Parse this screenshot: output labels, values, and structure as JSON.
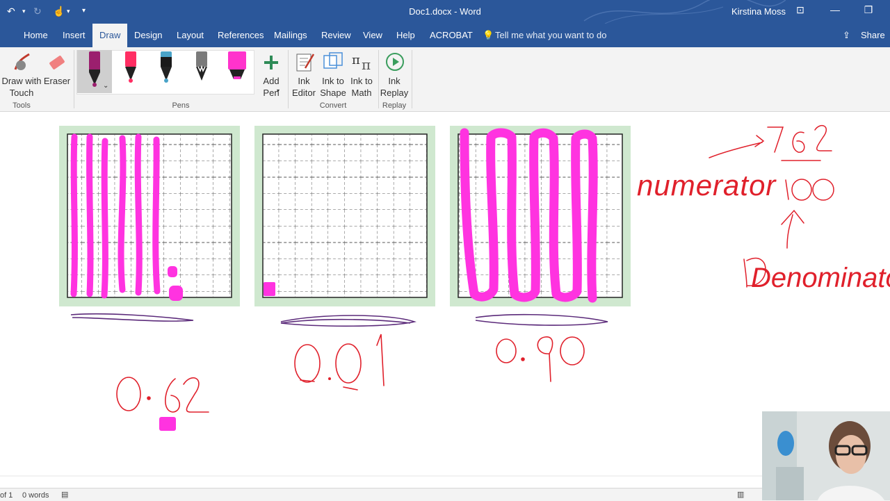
{
  "window": {
    "doc_title": "Doc1.docx  -  Word",
    "user_name": "Kirstina Moss"
  },
  "tabs": [
    "Home",
    "Insert",
    "Draw",
    "Design",
    "Layout",
    "References",
    "Mailings",
    "Review",
    "View",
    "Help",
    "ACROBAT"
  ],
  "active_tab": "Draw",
  "tell_me_placeholder": "Tell me what you want to do",
  "share_label": "Share",
  "ribbon": {
    "draw_with_touch": "Draw with Touch",
    "eraser": "Eraser",
    "add_pen": "Add Pen",
    "ink_editor": "Ink Editor",
    "ink_to_shape": "Ink to Shape",
    "ink_to_math": "Ink to Math",
    "ink_replay": "Ink Replay",
    "groups": {
      "tools": "Tools",
      "pens": "Pens",
      "convert": "Convert",
      "replay": "Replay"
    },
    "pen_colors": [
      "#9b1f6e",
      "#ff2e63",
      "#1a1a1a",
      "#7a7a7a",
      "#ff33cc"
    ]
  },
  "colors": {
    "brand": "#2b579a",
    "ink_red": "#e0202b",
    "ink_magenta": "#ff33e0",
    "ink_purple": "#5b2a7a",
    "grid_card": "#cfe8cf"
  },
  "document": {
    "grid1_value": "0.62",
    "grid2_value": "0.01",
    "grid3_value": "0.90",
    "annotation_numerator": "numerator",
    "annotation_fraction_top": "62",
    "annotation_fraction_bottom": "100",
    "annotation_denominator": "Denominato"
  },
  "status": {
    "page": "of 1",
    "words": "0 words"
  }
}
